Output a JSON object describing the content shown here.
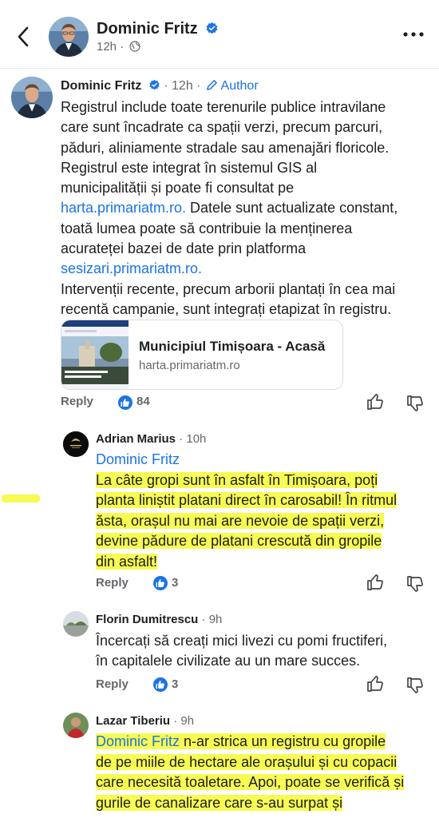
{
  "header": {
    "name": "Dominic Fritz",
    "meta": "12h ·"
  },
  "main_comment": {
    "name": "Dominic Fritz",
    "meta": "· 12h ·",
    "author_label": "Author",
    "lines": [
      "Registrul include toate terenurile publice intravilane",
      "care sunt încadrate ca spații verzi, precum parcuri,",
      "păduri, aliniamente stradale sau amenajări floricole.",
      "Registrul este integrat în sistemul GIS al",
      "municipalității și poate fi consultat pe"
    ],
    "link1": "harta.primariatm.ro.",
    "line_after_link1": " Datele sunt actualizate constant,",
    "lines2": [
      "toată lumea poate să contribuie la menținerea",
      "acurateței bazei de date prin platforma"
    ],
    "link2": "sesizari.primariatm.ro.",
    "lines3": [
      "Intervenții recente, precum arborii plantați în cea mai",
      "recentă campanie, sunt integrați etapizat în registru."
    ],
    "preview": {
      "title": "Municipiul Timișoara - Acasă",
      "url": "harta.primariatm.ro"
    },
    "reply_label": "Reply",
    "likes": "84"
  },
  "replies": [
    {
      "name": "Adrian Marius",
      "meta": "· 10h",
      "mention": "Dominic Fritz",
      "lines": [
        "La câte gropi sunt în asfalt în Timișoara, poți",
        "planta liniștit platani direct în carosabil! În ritmul",
        "ăsta, orașul nu mai are nevoie de spații verzi,",
        "devine pădure de platani crescută din gropile",
        "din asfalt!"
      ],
      "reply_label": "Reply",
      "likes": "3"
    },
    {
      "name": "Florin Dumitrescu",
      "meta": "· 9h",
      "lines": [
        "Încercați să creați mici livezi cu pomi fructiferi,",
        "în capitalele civilizate au un mare succes."
      ],
      "reply_label": "Reply",
      "likes": "3"
    },
    {
      "name": "Lazar Tiberiu",
      "meta": "· 9h",
      "mention": "Dominic Fritz",
      "first_line_rest": " n-ar strica un registru cu gropile",
      "lines": [
        "de pe miile de hectare ale orașului și cu copacii",
        "care necesită toaletare. Apoi, poate se verifică și",
        "gurile de canalizare care s-au surpat și"
      ]
    }
  ],
  "colors": {
    "link": "#1b74e4",
    "highlight": "#f7fb52",
    "secondary_text": "#65676b"
  },
  "icons": [
    "back-arrow-icon",
    "verified-badge-icon",
    "globe-icon",
    "more-options-icon",
    "pencil-icon",
    "like-thumb-icon",
    "thumbs-up-icon",
    "thumbs-down-icon"
  ]
}
